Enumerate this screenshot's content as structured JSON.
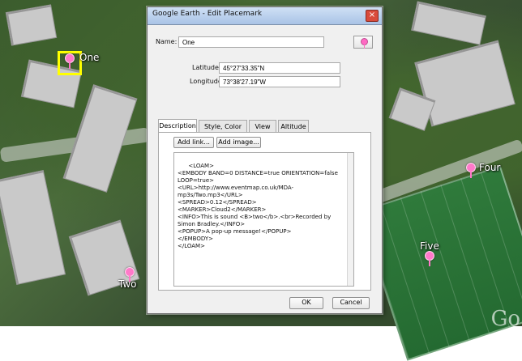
{
  "window": {
    "title": "Google Earth - Edit Placemark",
    "close_glyph": "×"
  },
  "placemark": {
    "name_label": "Name:",
    "name_value": "One",
    "latitude_label": "Latitude:",
    "latitude_value": "45°27'33.35\"N",
    "longitude_label": "Longitude:",
    "longitude_value": "73°38'27.19\"W"
  },
  "tabs": [
    "Description",
    "Style, Color",
    "View",
    "Altitude"
  ],
  "description": {
    "add_link_label": "Add link...",
    "add_image_label": "Add image...",
    "text": "<LOAM>\n<EMBODY BAND=0 DISTANCE=true ORIENTATION=false LOOP=true>\n<URL>http://www.eventmap.co.uk/MDA-mp3s/Two.mp3</URL>\n<SPREAD>0.12</SPREAD>\n<MARKER>Cloud2</MARKER>\n<INFO>This is sound <B>two</b>.<br>Recorded by Simon Bradley.</INFO>\n<POPUP>A pop-up message!</POPUP>\n</EMBODY>\n</LOAM>"
  },
  "footer": {
    "ok_label": "OK",
    "cancel_label": "Cancel"
  },
  "map": {
    "placemarks": [
      {
        "label": "One"
      },
      {
        "label": "Two"
      },
      {
        "label": "Four"
      },
      {
        "label": "Five"
      }
    ],
    "watermark": "Go"
  },
  "icons": {
    "placemark_icon": "pink-pin-icon"
  }
}
